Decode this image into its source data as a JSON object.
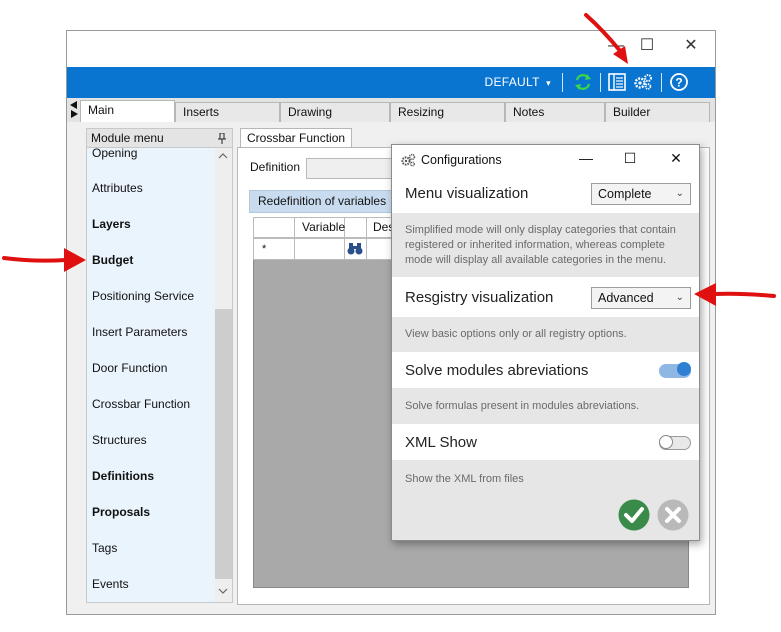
{
  "window": {
    "minimize": "—",
    "maximize": "☐",
    "close": "✕"
  },
  "toolbar": {
    "profile": "DEFAULT",
    "profile_chevron": "▾"
  },
  "tabs": [
    {
      "label": "Main",
      "active": true
    },
    {
      "label": "Inserts",
      "active": false
    },
    {
      "label": "Drawing",
      "active": false
    },
    {
      "label": "Resizing",
      "active": false
    },
    {
      "label": "Notes",
      "active": false
    },
    {
      "label": "Builder",
      "active": false
    }
  ],
  "module_menu": {
    "title": "Module menu",
    "items": [
      {
        "label": "Opening",
        "bold": false
      },
      {
        "label": "Attributes",
        "bold": false
      },
      {
        "label": "Layers",
        "bold": true
      },
      {
        "label": "Budget",
        "bold": true
      },
      {
        "label": "Positioning Service",
        "bold": false
      },
      {
        "label": "Insert Parameters",
        "bold": false
      },
      {
        "label": "Door Function",
        "bold": false
      },
      {
        "label": "Crossbar Function",
        "bold": false
      },
      {
        "label": "Structures",
        "bold": false
      },
      {
        "label": "Definitions",
        "bold": true
      },
      {
        "label": "Proposals",
        "bold": true
      },
      {
        "label": "Tags",
        "bold": false
      },
      {
        "label": "Events",
        "bold": false
      }
    ]
  },
  "content": {
    "tab_label": "Crossbar Function",
    "definition_label": "Definition",
    "section_title": "Redefinition of variables",
    "grid_headers": [
      "Variable",
      "Des"
    ],
    "new_row_marker": "*"
  },
  "dialog": {
    "title": "Configurations",
    "minimize": "—",
    "maximize": "☐",
    "close": "✕",
    "menu_visualization": {
      "label": "Menu visualization",
      "value": "Complete",
      "description": "Simplified mode will only display categories that contain registered or inherited information, whereas complete mode will display all available categories in the menu."
    },
    "registry_visualization": {
      "label": "Resgistry visualization",
      "value": "Advanced",
      "description": "View basic options only or all registry options."
    },
    "solve_abbreviations": {
      "label": "Solve modules abreviations",
      "enabled": true,
      "description": "Solve formulas present in modules abreviations."
    },
    "xml_show": {
      "label": "XML Show",
      "enabled": false,
      "description": "Show the XML from files"
    }
  },
  "colors": {
    "toolbar_blue": "#0a74d1",
    "annotation_red": "#e01010",
    "confirm_green": "#3a8a4a",
    "toggle_on": "#2f7fd3"
  }
}
